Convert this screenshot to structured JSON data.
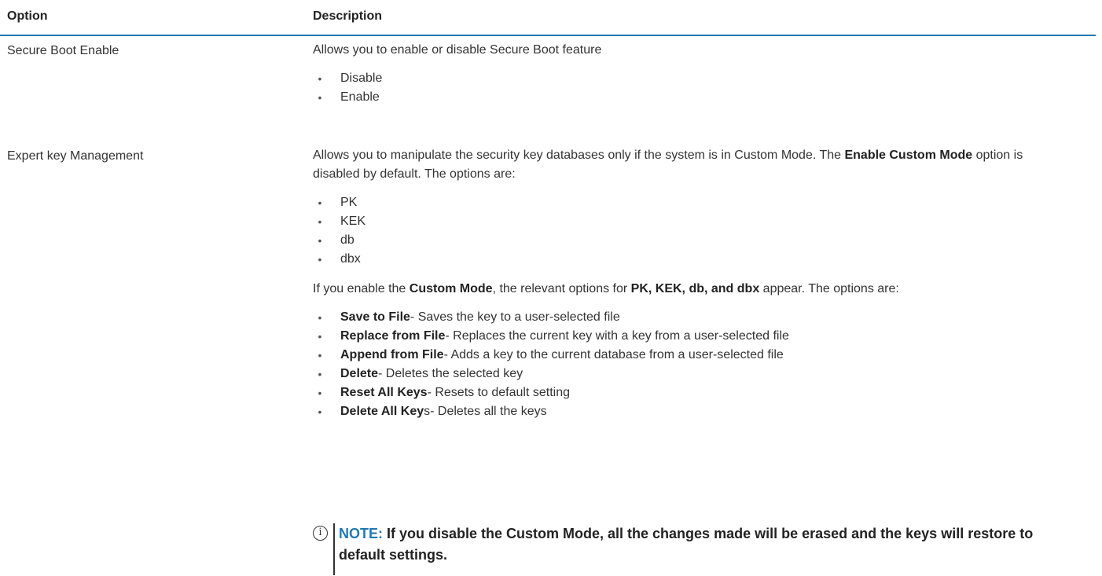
{
  "table": {
    "header": {
      "option": "Option",
      "description": "Description"
    },
    "row1": {
      "option": "Secure Boot Enable",
      "description": "Allows you to enable or disable Secure Boot feature",
      "items": [
        "Disable",
        "Enable"
      ]
    },
    "row2": {
      "option": "Expert key Management",
      "intro_pre": "Allows you to manipulate the security key databases only if the system is in Custom Mode. The ",
      "intro_bold": "Enable Custom Mode",
      "intro_post": " option is disabled by default. The options are:",
      "keys": [
        "PK",
        "KEK",
        "db",
        "dbx"
      ],
      "custom_pre": "If you enable the ",
      "custom_bold1": "Custom Mode",
      "custom_mid": ", the relevant options for ",
      "custom_bold2": "PK, KEK, db, and dbx",
      "custom_post": " appear. The options are:",
      "actions": [
        {
          "bold": "Save to File",
          "text": "- Saves the key to a user-selected file"
        },
        {
          "bold": "Replace from File",
          "text": "- Replaces the current key with a key from a user-selected file"
        },
        {
          "bold": "Append from File",
          "text": "- Adds a key to the current database from a user-selected file"
        },
        {
          "bold": "Delete",
          "text": "- Deletes the selected key"
        },
        {
          "bold": "Reset All Keys",
          "text": "- Resets to default setting"
        },
        {
          "bold": "Delete All Key",
          "text": "s- Deletes all the keys"
        }
      ],
      "note_label": "NOTE:",
      "note_text": " If you disable the Custom Mode, all the changes made will be erased and the keys will restore to default settings."
    }
  },
  "bullet_glyph": "•",
  "info_icon_glyph": "i",
  "colors": {
    "accent": "#1e7ab4",
    "text": "#333333"
  }
}
